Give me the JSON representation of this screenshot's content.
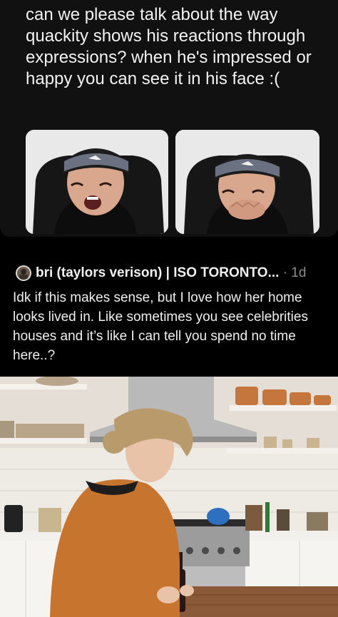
{
  "quoted_post": {
    "text": "can we please talk about the way quackity shows his reactions through expressions? when he's impressed or happy you can see it in his face :("
  },
  "reply": {
    "author": "bri (taylors verison) | ISO TORONTO...",
    "separator": "·",
    "time": "1d",
    "text": "Idk if this makes sense, but I love how her home looks lived in. Like sometimes you see celebrities houses and it’s like I can tell you spend no time here..?"
  },
  "colors": {
    "background": "#000000",
    "quoted_card": "#111111",
    "text": "#efefef",
    "meta": "#8b8b8b"
  }
}
